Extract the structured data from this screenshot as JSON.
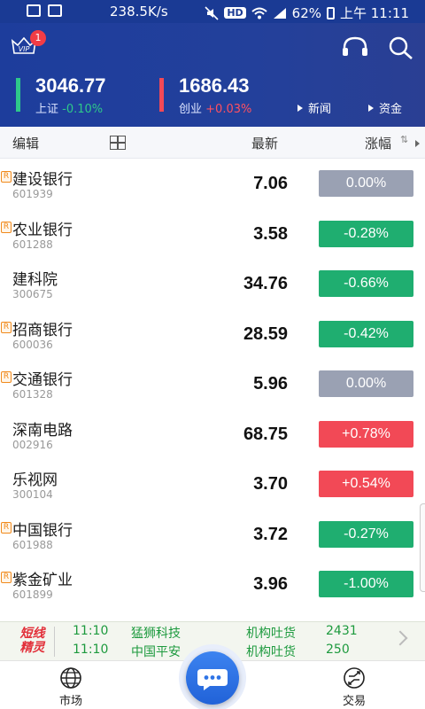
{
  "status_bar": {
    "speed": "238.5K/s",
    "hd": "HD",
    "battery": "62%",
    "time": "上午 11:11"
  },
  "header": {
    "vip_badge_count": "1",
    "vip_label": "VIP",
    "indices": [
      {
        "value": "3046.77",
        "name": "上证",
        "change": "-0.10%",
        "trend": "down"
      },
      {
        "value": "1686.43",
        "name": "创业",
        "change": "+0.03%",
        "trend": "up"
      }
    ],
    "links": {
      "news": "新闻",
      "funds": "资金"
    }
  },
  "columns": {
    "edit": "编辑",
    "latest": "最新",
    "change": "涨幅"
  },
  "stocks": [
    {
      "name": "建设银行",
      "code": "601939",
      "price": "7.06",
      "change": "0.00%",
      "direction": "flat",
      "r_badge": true
    },
    {
      "name": "农业银行",
      "code": "601288",
      "price": "3.58",
      "change": "-0.28%",
      "direction": "down",
      "r_badge": true
    },
    {
      "name": "建科院",
      "code": "300675",
      "price": "34.76",
      "change": "-0.66%",
      "direction": "down",
      "r_badge": false
    },
    {
      "name": "招商银行",
      "code": "600036",
      "price": "28.59",
      "change": "-0.42%",
      "direction": "down",
      "r_badge": true
    },
    {
      "name": "交通银行",
      "code": "601328",
      "price": "5.96",
      "change": "0.00%",
      "direction": "flat",
      "r_badge": true
    },
    {
      "name": "深南电路",
      "code": "002916",
      "price": "68.75",
      "change": "+0.78%",
      "direction": "up",
      "r_badge": false
    },
    {
      "name": "乐视网",
      "code": "300104",
      "price": "3.70",
      "change": "+0.54%",
      "direction": "up",
      "r_badge": false
    },
    {
      "name": "中国银行",
      "code": "601988",
      "price": "3.72",
      "change": "-0.27%",
      "direction": "down",
      "r_badge": true
    },
    {
      "name": "紫金矿业",
      "code": "601899",
      "price": "3.96",
      "change": "-1.00%",
      "direction": "down",
      "r_badge": true
    }
  ],
  "r_badge_label": "R",
  "ticker": {
    "logo_line1": "短线",
    "logo_line2": "精灵",
    "items": [
      {
        "time": "11:10",
        "stock": "猛狮科技",
        "event": "机构吐货",
        "volume": "2431"
      },
      {
        "time": "11:10",
        "stock": "中国平安",
        "event": "机构吐货",
        "volume": "250"
      }
    ]
  },
  "bottom_nav": {
    "market": "市场",
    "trade": "交易"
  },
  "colors": {
    "header_bg": "#1d3d9c",
    "up": "#f24956",
    "down": "#1fae70",
    "flat": "#9aa1b3",
    "fab": "#2e74e6"
  }
}
